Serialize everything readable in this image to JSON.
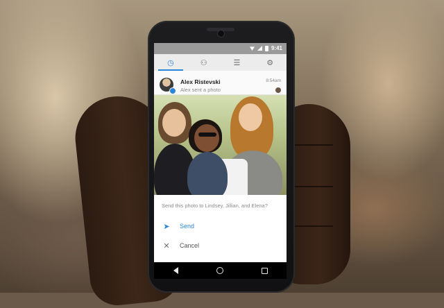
{
  "status_bar": {
    "time": "9:41",
    "icons": [
      "wifi-icon",
      "signal-icon",
      "battery-icon"
    ]
  },
  "tabs": [
    {
      "icon": "clock-icon",
      "active": true
    },
    {
      "icon": "people-icon",
      "active": false
    },
    {
      "icon": "list-icon",
      "active": false
    },
    {
      "icon": "gear-icon",
      "active": false
    }
  ],
  "notification": {
    "sender": "Alex Ristevski",
    "subtitle": "Alex sent a photo",
    "time": "8:54am"
  },
  "share": {
    "prompt": "Send this photo to Lindsey, Jillian, and Elena?",
    "send_label": "Send",
    "cancel_label": "Cancel"
  },
  "colors": {
    "accent": "#2a86d8",
    "status_bar_bg": "#9a9a9a",
    "tab_bar_bg": "#ececec"
  }
}
